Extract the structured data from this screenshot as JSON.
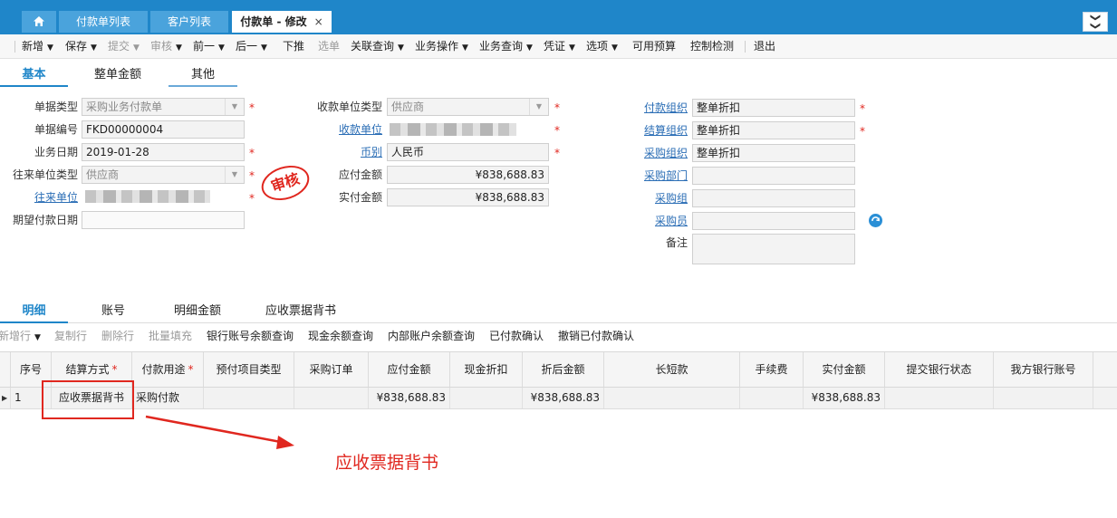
{
  "tabs": {
    "home_icon": "home-icon",
    "items": [
      "付款单列表",
      "客户列表",
      "付款单 - 修改"
    ],
    "close_glyph": "×",
    "collapse_glyph": "❯❯"
  },
  "toolbar": {
    "new": "新增",
    "save": "保存",
    "submit": "提交",
    "audit": "审核",
    "prev": "前一",
    "next": "后一",
    "push": "下推",
    "pull": "选单",
    "related_query": "关联查询",
    "business_ops": "业务操作",
    "business_query": "业务查询",
    "voucher": "凭证",
    "options": "选项",
    "available_budget": "可用预算",
    "control_check": "控制检测",
    "exit": "退出"
  },
  "header_tabs": [
    "基本",
    "整单金额",
    "其他"
  ],
  "form": {
    "doc_type_label": "单据类型",
    "doc_type_value": "采购业务付款单",
    "doc_no_label": "单据编号",
    "doc_no_value": "FKD00000004",
    "biz_date_label": "业务日期",
    "biz_date_value": "2019-01-28",
    "contact_type_label": "往来单位类型",
    "contact_type_value": "供应商",
    "contact_label": "往来单位",
    "expected_date_label": "期望付款日期",
    "payee_type_label": "收款单位类型",
    "payee_type_value": "供应商",
    "payee_label": "收款单位",
    "currency_label": "币别",
    "currency_value": "人民币",
    "payable_label": "应付金额",
    "payable_value": "¥838,688.83",
    "actual_label": "实付金额",
    "actual_value": "¥838,688.83",
    "pay_org_label": "付款组织",
    "pay_org_value": "整单折扣",
    "settle_org_label": "结算组织",
    "settle_org_value": "整单折扣",
    "purchase_org_label": "采购组织",
    "purchase_org_value": "整单折扣",
    "purchase_dept_label": "采购部门",
    "purchase_group_label": "采购组",
    "purchaser_label": "采购员",
    "remark_label": "备注",
    "stamp": "审核",
    "required_mark": "*"
  },
  "detail_tabs": [
    "明细",
    "账号",
    "明细金额",
    "应收票据背书"
  ],
  "detail_toolbar": {
    "add_row": "新增行",
    "copy_row": "复制行",
    "delete_row": "删除行",
    "batch_fill": "批量填充",
    "bank_balance": "银行账号余额查询",
    "cash_balance": "现金余额查询",
    "internal_balance": "内部账户余额查询",
    "paid_confirm": "已付款确认",
    "cancel_paid_confirm": "撤销已付款确认"
  },
  "grid": {
    "columns": [
      "序号",
      "结算方式",
      "付款用途",
      "预付项目类型",
      "采购订单",
      "应付金额",
      "现金折扣",
      "折后金额",
      "长短款",
      "手续费",
      "实付金额",
      "提交银行状态",
      "我方银行账号"
    ],
    "row": {
      "seq": "1",
      "settle_method": "应收票据背书",
      "purpose": "采购付款",
      "prepay_type": "",
      "po": "",
      "payable": "¥838,688.83",
      "cash_discount": "",
      "after_discount": "¥838,688.83",
      "over_short": "",
      "fee": "",
      "actual": "¥838,688.83",
      "bank_status": "",
      "our_account": ""
    }
  },
  "annotation": {
    "text": "应收票据背书",
    "color": "#e0271f"
  },
  "colors": {
    "accent": "#1f86c9",
    "required": "#e0271f",
    "link": "#2a6db5"
  }
}
